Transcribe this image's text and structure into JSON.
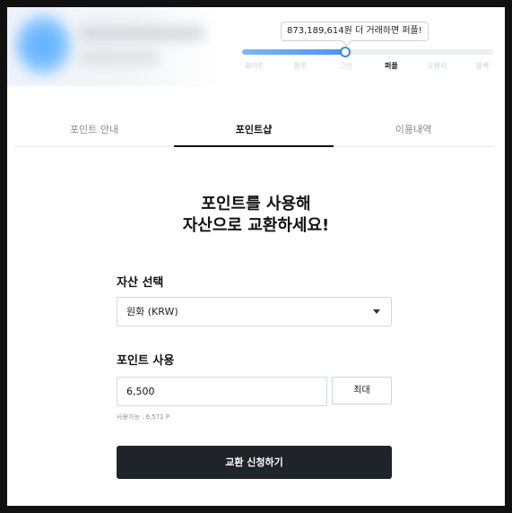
{
  "grade": {
    "tooltip": "873,189,614원 더 거래하면 퍼플!",
    "progress_percent": 41,
    "levels": [
      "화이트",
      "블루",
      "그린",
      "퍼플",
      "오렌지",
      "블랙"
    ],
    "current_index": 3
  },
  "tabs": [
    {
      "label": "포인트 안내",
      "active": false
    },
    {
      "label": "포인트샵",
      "active": true
    },
    {
      "label": "이용내역",
      "active": false
    }
  ],
  "main": {
    "headline_line1": "포인트를 사용해",
    "headline_line2": "자산으로 교환하세요!",
    "asset_label": "자산 선택",
    "asset_selected": "원화 (KRW)",
    "points_label": "포인트 사용",
    "points_value": "6,500",
    "max_label": "최대",
    "available_text": "사용가능 : 6,571 P",
    "submit_label": "교환 신청하기"
  },
  "colors": {
    "accent": "#4c95ee",
    "button_dark": "#1f232a"
  }
}
